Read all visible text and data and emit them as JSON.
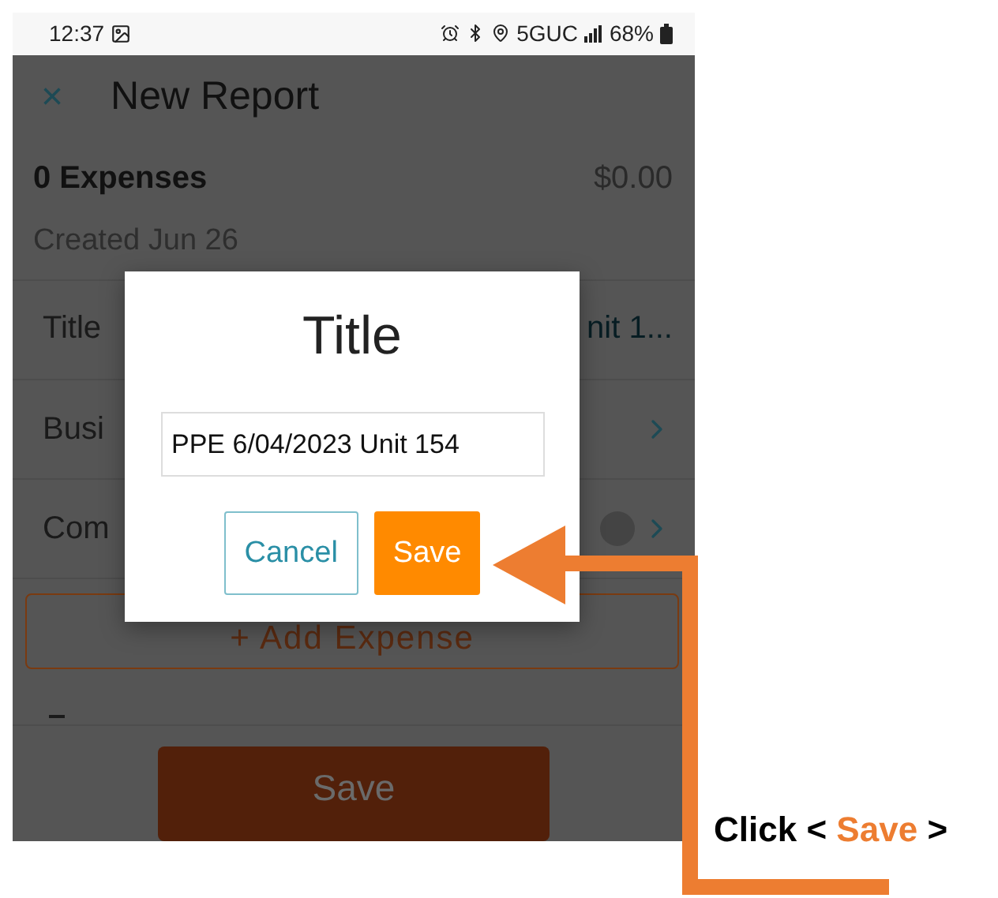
{
  "status_bar": {
    "time": "12:37",
    "network": "5GUC",
    "battery": "68%"
  },
  "header": {
    "close": "×",
    "title": "New Report"
  },
  "summary": {
    "count": "0 Expenses",
    "total": "$0.00",
    "created": "Created Jun 26"
  },
  "rows": [
    {
      "label": "Title",
      "value": "nit 1...",
      "kind": "value"
    },
    {
      "label": "Busi",
      "kind": "link"
    },
    {
      "label": "Com",
      "kind": "badge_link"
    }
  ],
  "add_button": "+ Add Expense",
  "save_button": "Save",
  "dialog": {
    "title": "Title",
    "value": "PPE 6/04/2023 Unit 154",
    "buttons": [
      {
        "label": "Cancel",
        "kind": "secondary"
      },
      {
        "label": "Save",
        "kind": "primary"
      }
    ]
  },
  "callout": {
    "prefix": "Click <",
    "action": "Save",
    "suffix": ">"
  }
}
